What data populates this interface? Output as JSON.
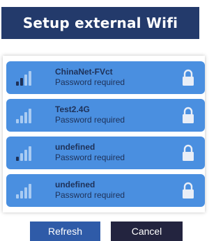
{
  "header": {
    "title": "Setup external Wifi"
  },
  "networks": [
    {
      "ssid": "ChinaNet-FVct",
      "status": "Password required",
      "signal_level": 2,
      "signal_max": 4,
      "icon": "lock-icon"
    },
    {
      "ssid": "Test2.4G",
      "status": "Password required",
      "signal_level": 0,
      "signal_max": 4,
      "icon": "lock-icon"
    },
    {
      "ssid": "undefined",
      "status": "Password required",
      "signal_level": 1,
      "signal_max": 4,
      "icon": "lock-icon"
    },
    {
      "ssid": "undefined",
      "status": "Password required",
      "signal_level": 0,
      "signal_max": 4,
      "icon": "lock-icon"
    }
  ],
  "buttons": {
    "refresh": "Refresh",
    "cancel": "Cancel"
  },
  "colors": {
    "header_bg": "#233a6b",
    "item_bg": "#4a8fe0",
    "signal_on": "#1e3158",
    "signal_off": "#a9cbf2",
    "refresh_bg": "#2f5ba8",
    "cancel_bg": "#23243f"
  }
}
